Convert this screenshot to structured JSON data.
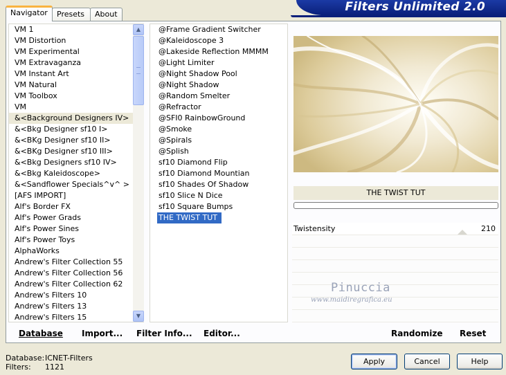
{
  "tabs": [
    {
      "label": "Navigator",
      "active": true
    },
    {
      "label": "Presets",
      "active": false
    },
    {
      "label": "About",
      "active": false
    }
  ],
  "banner_title": "Filters Unlimited 2.0",
  "categories": [
    "VM 1",
    "VM Distortion",
    "VM Experimental",
    "VM Extravaganza",
    "VM Instant Art",
    "VM Natural",
    "VM Toolbox",
    "VM",
    "&<Background Designers IV>",
    "&<Bkg Designer sf10 I>",
    "&<BKg Designer sf10 II>",
    "&<BKg Designer sf10 III>",
    "&<Bkg Designers sf10 IV>",
    "&<Bkg Kaleidoscope>",
    "&<Sandflower Specials^v^ >",
    "[AFS IMPORT]",
    "Alf's Border FX",
    "Alf's Power Grads",
    "Alf's Power Sines",
    "Alf's Power Toys",
    "AlphaWorks",
    "Andrew's Filter Collection 55",
    "Andrew's Filter Collection 56",
    "Andrew's Filter Collection 62",
    "Andrew's Filters 10",
    "Andrew's Filters 13",
    "Andrew's Filters 15"
  ],
  "selected_category": "&<Background Designers IV>",
  "filters": [
    "@Frame Gradient Switcher",
    "@Kaleidoscope 3",
    "@Lakeside Reflection MMMM",
    "@Light Limiter",
    "@Night Shadow Pool",
    "@Night Shadow",
    "@Random Smelter",
    "@Refractor",
    "@SFI0 RainbowGround",
    "@Smoke",
    "@Spirals",
    "@Splish",
    "sf10 Diamond Flip",
    "sf10 Diamond Mountian",
    "sf10 Shades Of Shadow",
    "sf10 Slice N Dice",
    "sf10 Square Bumps",
    "THE TWIST TUT"
  ],
  "selected_filter": "THE TWIST TUT",
  "preview": {
    "filter_title": "THE TWIST TUT",
    "param_label": "Twistensity",
    "param_value": "210"
  },
  "watermark": {
    "name": "Pinuccia",
    "url": "www.maidiregrafica.eu"
  },
  "links": {
    "database": "Database",
    "import": "Import...",
    "filter_info": "Filter Info...",
    "editor": "Editor...",
    "randomize": "Randomize",
    "reset": "Reset"
  },
  "status": {
    "database_label": "Database:",
    "database_value": "ICNET-Filters",
    "filters_label": "Filters:",
    "filters_value": "1121"
  },
  "buttons": {
    "apply": "Apply",
    "cancel": "Cancel",
    "help": "Help"
  },
  "colors": {
    "selection": "#316ac5",
    "banner": "#0a1f7a",
    "tab_highlight": "#f9b340"
  }
}
